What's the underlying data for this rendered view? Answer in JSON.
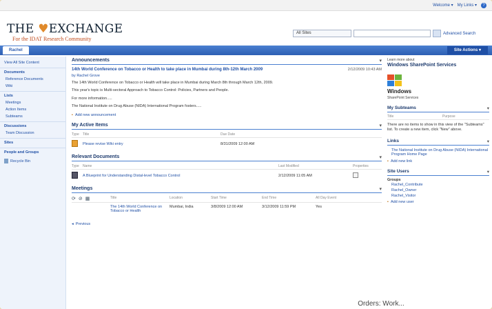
{
  "topbar": {
    "welcome": "Welcome ▾",
    "my_links": "My Links ▾",
    "help": "?"
  },
  "logo": {
    "text_left": "THE ",
    "text_v": "♥",
    "text_right": "EXCHANGE",
    "tagline": "For the IDAT Research Community"
  },
  "search": {
    "scope": "All Sites",
    "input_value": "",
    "advanced": "Advanced Search"
  },
  "nav": {
    "tab": "Rachel",
    "site_actions": "Site Actions ▾"
  },
  "sidebar": {
    "view_all": "View All Site Content",
    "documents": {
      "label": "Documents",
      "items": [
        "Reference Documents",
        "Wiki"
      ]
    },
    "lists": {
      "label": "Lists",
      "items": [
        "Meetings",
        "Action Items",
        "Subteams"
      ]
    },
    "discussions": {
      "label": "Discussions",
      "items": [
        "Team Discussion"
      ]
    },
    "sites": "Sites",
    "people": "People and Groups",
    "recycle": "Recycle Bin"
  },
  "announcements": {
    "title": "Announcements",
    "item_title": "14th World Conference on Tobacco or Health to take place in Mumbai during 8th-12th March 2009",
    "date": "2/12/2009 10:43 AM",
    "by": "by Rachel Grove",
    "paragraphs": [
      "The 14th World Conference on Tobacco or Health will take place in Mumbai during March 8th through March 12th, 2009.",
      "This year's topic is Multi-sectoral Approach to Tobacco Control: Policies, Partners and People.",
      "For more information.....",
      "The National Institute on Drug Abuse (NIDA) International Program fosters....."
    ],
    "add": "Add new announcement"
  },
  "active_items": {
    "title": "My Active Items",
    "headers": [
      "Type",
      "Title",
      "Due Date"
    ],
    "rows": [
      {
        "title": "Please revise Wiki entry",
        "due": "8/31/2009 12:00 AM"
      }
    ]
  },
  "relevant_docs": {
    "title": "Relevant Documents",
    "headers": [
      "Type",
      "Name",
      "Last Modified",
      "Properties"
    ],
    "rows": [
      {
        "name": "A Blueprint for Understanding Distal-level Tobacco Control",
        "modified": "2/12/2009 11:05 AM"
      }
    ]
  },
  "meetings": {
    "title": "Meetings",
    "headers": [
      "Title",
      "Location",
      "Start Time",
      "End Time",
      "All Day Event"
    ],
    "rows": [
      {
        "title": "The 14th World Conference on Tobacco or Health",
        "location": "Mumbai, India",
        "start": "3/8/2009 12:00 AM",
        "end": "3/12/2009 11:59 PM",
        "allday": "Yes"
      }
    ],
    "previous": "Previous"
  },
  "right": {
    "wss_head": "Learn more about",
    "wss_title": "Windows SharePoint Services",
    "win_word": "Windows",
    "win_sub": "SharePoint Services",
    "subteams": {
      "title": "My Subteams",
      "headers": [
        "Title",
        "Purpose"
      ],
      "text": "There are no items to show in this view of the \"Subteams\" list. To create a new item, click \"New\" above."
    },
    "links": {
      "title": "Links",
      "items": [
        "The National Institute on Drug Abuse (NIDA) International Program Home Page"
      ],
      "add": "Add new link"
    },
    "users": {
      "title": "Site Users",
      "group": "Groups",
      "items": [
        "Rachel_Contribute",
        "Rachel_Owner",
        "Rachel_Visitor"
      ],
      "add": "Add new user"
    }
  },
  "caption": "Orders: Work..."
}
